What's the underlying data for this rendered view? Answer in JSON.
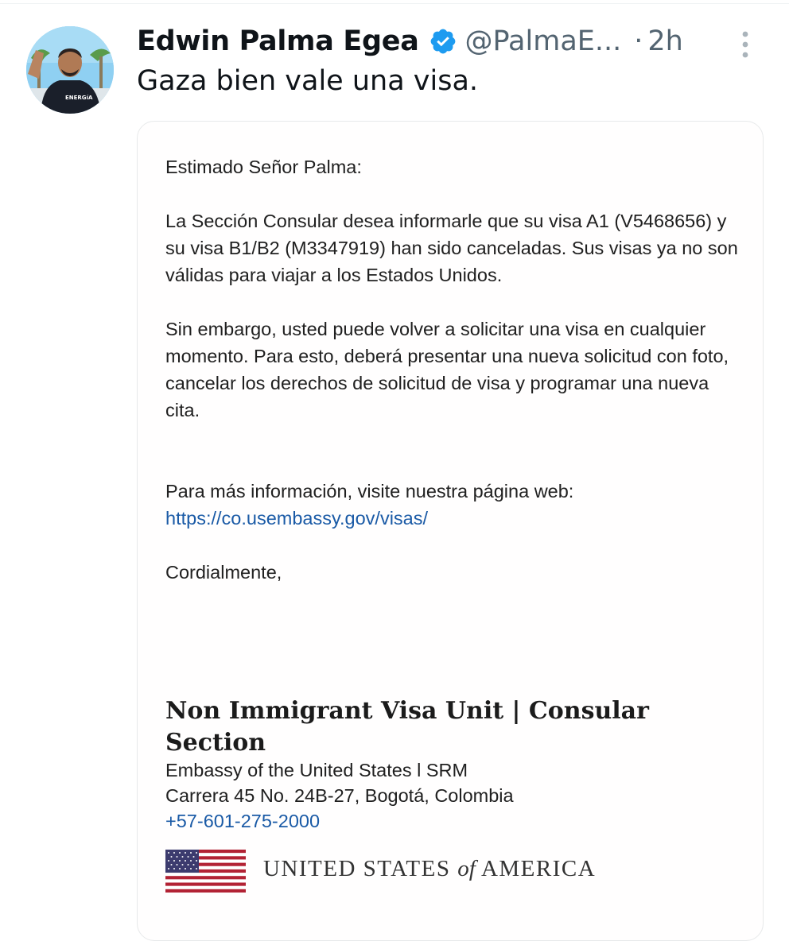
{
  "tweet": {
    "author": {
      "name": "Edwin Palma Egea",
      "handle": "@PalmaE...",
      "verified": true,
      "avatar_shirt_text": "ENERGíA"
    },
    "separator": "·",
    "timestamp": "2h",
    "text": "Gaza bien vale una visa.",
    "icons": {
      "verified": "verified-badge-icon",
      "more": "more-options-icon"
    },
    "colors": {
      "verified_badge": "#1d9bf0",
      "secondary_text": "#536471",
      "link": "#1a5aa6"
    }
  },
  "letter": {
    "greeting": "Estimado Señor Palma:",
    "paragraph1": "La Sección Consular desea informarle que su visa A1 (V5468656) y su visa B1/B2 (M3347919) han sido canceladas. Sus visas ya no son válidas para viajar a los Estados Unidos.",
    "paragraph2": "Sin embargo, usted puede volver a solicitar una visa en cualquier momento. Para esto, deberá presentar una nueva solicitud con foto, cancelar los derechos de solicitud de visa y programar una nueva cita.",
    "info_text": "Para más información, visite nuestra página web:",
    "info_link": "https://co.usembassy.gov/visas/",
    "closing": "Cordialmente,",
    "signature": {
      "title": "Non Immigrant Visa Unit | Consular Section",
      "line1": "Embassy of the United States l SRM",
      "line2": "Carrera 45 No. 24B-27, Bogotá, Colombia",
      "phone": "+57-601-275-2000"
    },
    "wordmark": {
      "part1": "UNITED STATES ",
      "part2": "of",
      "part3": " AMERICA"
    }
  }
}
